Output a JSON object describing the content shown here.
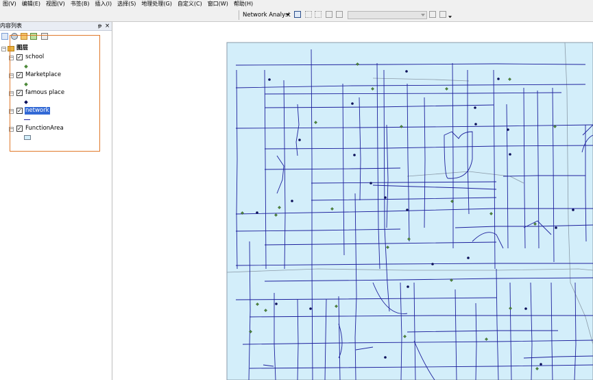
{
  "menus": [
    "图(V)",
    "编辑(E)",
    "视图(V)",
    "书签(B)",
    "插入(I)",
    "选择(S)",
    "地理处理(G)",
    "自定义(C)",
    "窗口(W)",
    "帮助(H)"
  ],
  "toolbar": {
    "network_analyst_label": "Network Analyst"
  },
  "toc": {
    "title": "内容列表",
    "pin_glyph": "ᵽ",
    "close_glyph": "×",
    "root": {
      "label": "图层"
    },
    "layers": [
      {
        "name": "school",
        "checked": true,
        "symbol": "green-diamond"
      },
      {
        "name": "Marketplace",
        "checked": true,
        "symbol": "green-diamond"
      },
      {
        "name": "famous place",
        "checked": true,
        "symbol": "navy-diamond"
      },
      {
        "name": "network",
        "checked": true,
        "symbol": "blue-line",
        "selected": true
      },
      {
        "name": "FunctionArea",
        "checked": true,
        "symbol": "lightblue-fill"
      }
    ]
  },
  "colors": {
    "map_fill": "#d3eefa",
    "road": "#1c1f9c",
    "green_point": "#4d8a3a",
    "navy_point": "#0b0f5a",
    "selection": "#3168d5",
    "highlight_box": "#e0782a"
  }
}
